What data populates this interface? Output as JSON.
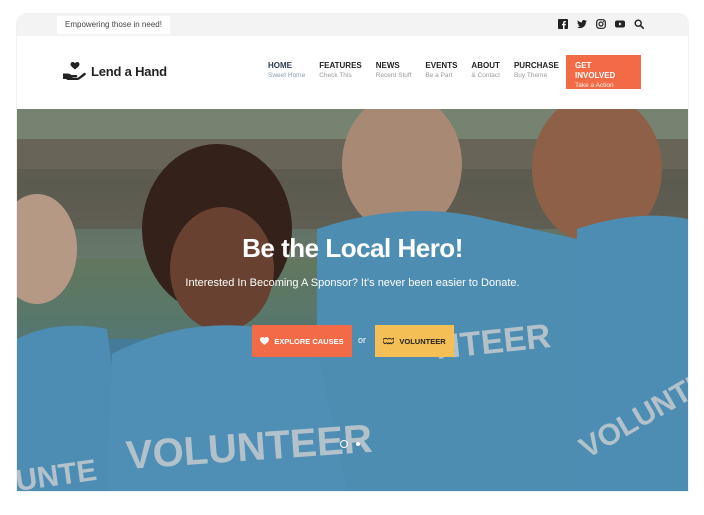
{
  "topbar": {
    "tagline": "Empowering those in need!",
    "social_icons": [
      "facebook-icon",
      "twitter-icon",
      "instagram-icon",
      "youtube-icon",
      "search-icon"
    ]
  },
  "header": {
    "logo_text": "Lend a Hand",
    "nav": [
      {
        "label": "HOME",
        "sub": "Sweet Home"
      },
      {
        "label": "FEATURES",
        "sub": "Check This"
      },
      {
        "label": "NEWS",
        "sub": "Recent Stuff"
      },
      {
        "label": "EVENTS",
        "sub": "Be a Part"
      },
      {
        "label": "ABOUT",
        "sub": "& Contact"
      },
      {
        "label": "PURCHASE",
        "sub": "Buy Theme"
      }
    ],
    "cta": {
      "label": "GET INVOLVED",
      "sub": "Take a Action"
    }
  },
  "hero": {
    "title": "Be the Local Hero!",
    "subtitle": "Interested In Becoming A Sponsor? It's never been easier to Donate.",
    "btn_causes": "EXPLORE CAUSES",
    "or_text": "or",
    "btn_volunteer": "VOLUNTEER",
    "shirt_text": "VOLUNTEER"
  },
  "colors": {
    "accent_orange": "#f26a46",
    "accent_yellow": "#f4bf55",
    "shirt_blue": "#5aa7d3"
  }
}
